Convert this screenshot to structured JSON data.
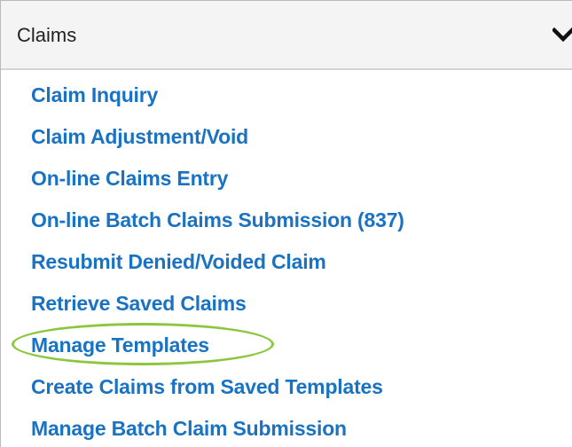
{
  "panel": {
    "title": "Claims",
    "toggle_icon": "chevron-down-icon"
  },
  "links": [
    {
      "label": "Claim Inquiry"
    },
    {
      "label": "Claim Adjustment/Void"
    },
    {
      "label": "On-line Claims Entry"
    },
    {
      "label": "On-line Batch Claims Submission (837)"
    },
    {
      "label": "Resubmit Denied/Voided Claim"
    },
    {
      "label": "Retrieve Saved Claims"
    },
    {
      "label": "Manage Templates"
    },
    {
      "label": "Create Claims from Saved Templates"
    },
    {
      "label": "Manage Batch Claim Submission"
    }
  ],
  "highlight": {
    "target": "Manage Templates",
    "color": "#8cc63f"
  },
  "colors": {
    "link": "#1a73c2",
    "header_bg": "#f4f4f4"
  }
}
